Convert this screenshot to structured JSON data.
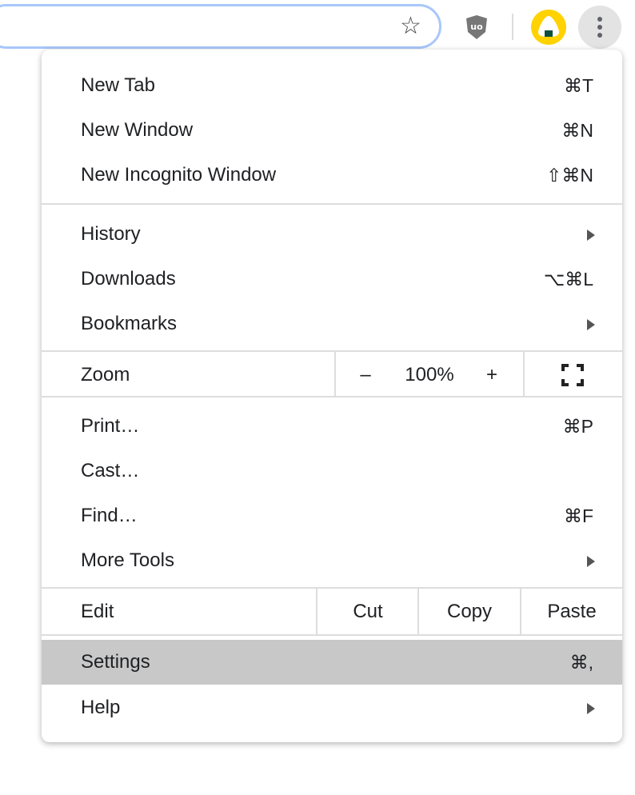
{
  "toolbar": {
    "icons": [
      "star-icon",
      "ublock-origin-icon",
      "profile-avatar-icon",
      "more-menu-icon"
    ],
    "accent": "#a8c7fa",
    "avatar_color": "#ffd200"
  },
  "menu": {
    "group1": [
      {
        "label": "New Tab",
        "shortcut": "⌘T"
      },
      {
        "label": "New Window",
        "shortcut": "⌘N"
      },
      {
        "label": "New Incognito Window",
        "shortcut": "⇧⌘N"
      }
    ],
    "group2": [
      {
        "label": "History",
        "submenu": true
      },
      {
        "label": "Downloads",
        "shortcut": "⌥⌘L"
      },
      {
        "label": "Bookmarks",
        "submenu": true
      }
    ],
    "zoom": {
      "label": "Zoom",
      "minus": "–",
      "value": "100%",
      "plus": "+"
    },
    "group3": [
      {
        "label": "Print…",
        "shortcut": "⌘P"
      },
      {
        "label": "Cast…"
      },
      {
        "label": "Find…",
        "shortcut": "⌘F"
      },
      {
        "label": "More Tools",
        "submenu": true
      }
    ],
    "edit": {
      "label": "Edit",
      "cut": "Cut",
      "copy": "Copy",
      "paste": "Paste"
    },
    "group4": [
      {
        "label": "Settings",
        "shortcut": "⌘,",
        "highlighted": true
      },
      {
        "label": "Help",
        "submenu": true
      }
    ]
  }
}
